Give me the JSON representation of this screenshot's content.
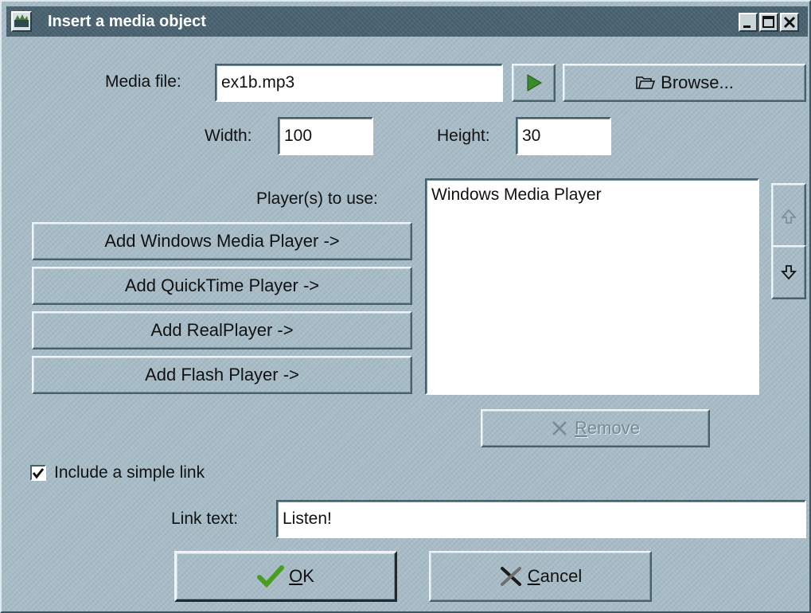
{
  "window": {
    "title": "Insert a media object",
    "controls": {
      "minimize": "_",
      "maximize": "□",
      "close": "×"
    }
  },
  "media_file": {
    "label": "Media file:",
    "value": "ex1b.mp3"
  },
  "browse": {
    "label": "Browse..."
  },
  "width": {
    "label": "Width:",
    "value": "100"
  },
  "height": {
    "label": "Height:",
    "value": "30"
  },
  "players": {
    "label": "Player(s) to use:",
    "list": [
      "Windows Media Player"
    ],
    "add_buttons": [
      "Add Windows Media Player ->",
      "Add QuickTime Player ->",
      "Add RealPlayer ->",
      "Add Flash Player ->"
    ]
  },
  "remove": {
    "mnemonic": "R",
    "rest": "emove"
  },
  "include_link": {
    "label": "Include a simple link",
    "checked": true
  },
  "link_text": {
    "label": "Link text:",
    "value": "Listen!"
  },
  "ok": {
    "mnemonic": "O",
    "rest": "K"
  },
  "cancel": {
    "mnemonic": "C",
    "rest": "ancel"
  },
  "colors": {
    "accent_play": "#3c8a2a",
    "ok_check": "#4a9e1f"
  }
}
